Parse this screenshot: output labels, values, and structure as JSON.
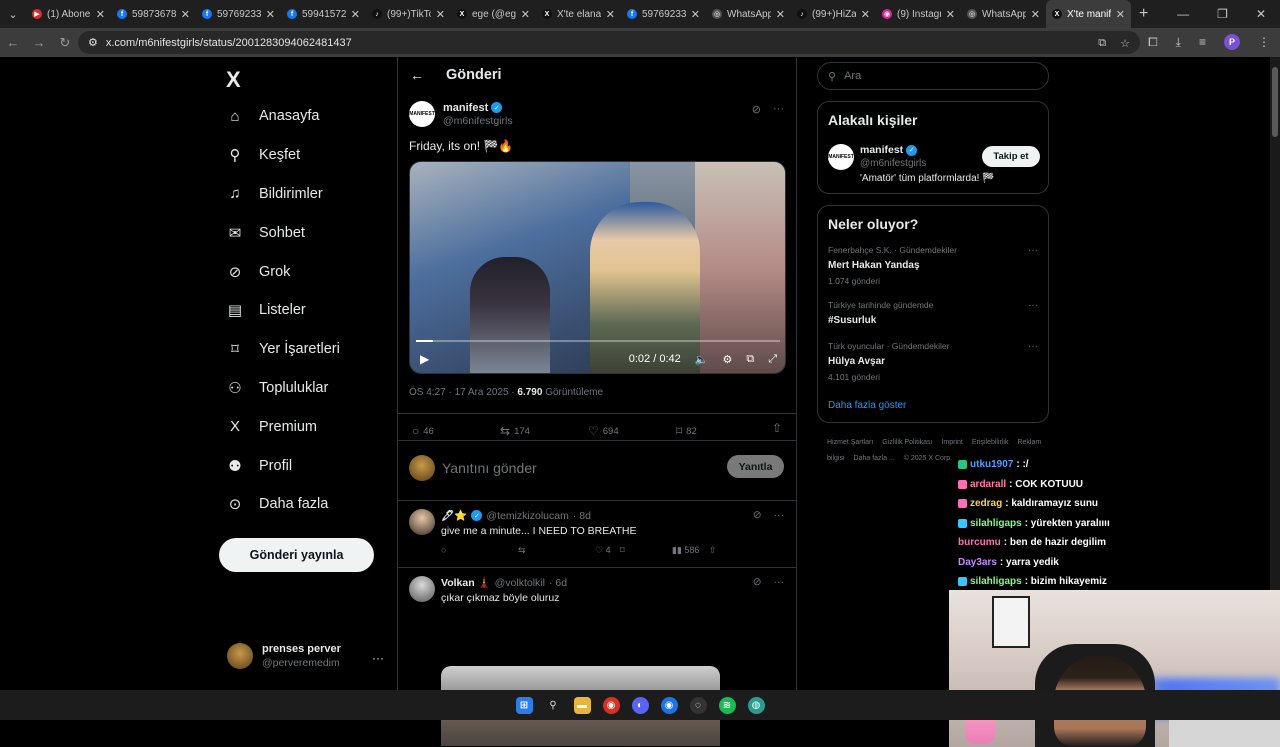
{
  "browser": {
    "tabs": [
      {
        "label": "(1) Abone",
        "color": "#e32b2b",
        "glyph": "▶"
      },
      {
        "label": "59873678",
        "color": "#1877f2",
        "glyph": "f"
      },
      {
        "label": "59769233",
        "color": "#1877f2",
        "glyph": "f"
      },
      {
        "label": "59941572",
        "color": "#1877f2",
        "glyph": "f"
      },
      {
        "label": "(99+)TikTo",
        "color": "#111111",
        "glyph": "♪"
      },
      {
        "label": "ege (@ege",
        "color": "#111111",
        "glyph": "X"
      },
      {
        "label": "X'te elanat",
        "color": "#111111",
        "glyph": "X"
      },
      {
        "label": "59769233",
        "color": "#1877f2",
        "glyph": "f"
      },
      {
        "label": "WhatsApp",
        "color": "#555555",
        "glyph": "◎"
      },
      {
        "label": "(99+)HiZa",
        "color": "#111111",
        "glyph": "♪"
      },
      {
        "label": "(9) Instagr",
        "color": "#d6249f",
        "glyph": "◉"
      },
      {
        "label": "WhatsApp",
        "color": "#555555",
        "glyph": "◎"
      },
      {
        "label": "X'te manif",
        "color": "#111111",
        "glyph": "X",
        "active": true
      }
    ],
    "url": "x.com/m6nifestgirls/status/2001283094062481437",
    "profile_initial": "P"
  },
  "nav": {
    "logo": "X",
    "items": [
      {
        "label": "Anasayfa",
        "icon": "⌂",
        "icon_name": "home-icon"
      },
      {
        "label": "Keşfet",
        "icon": "⚲",
        "icon_name": "search-icon"
      },
      {
        "label": "Bildirimler",
        "icon": "♫",
        "icon_name": "bell-icon"
      },
      {
        "label": "Sohbet",
        "icon": "✉",
        "icon_name": "mail-icon"
      },
      {
        "label": "Grok",
        "icon": "⊘",
        "icon_name": "grok-icon"
      },
      {
        "label": "Listeler",
        "icon": "▤",
        "icon_name": "list-icon"
      },
      {
        "label": "Yer İşaretleri",
        "icon": "⌑",
        "icon_name": "bookmark-icon"
      },
      {
        "label": "Topluluklar",
        "icon": "⚇",
        "icon_name": "communities-icon"
      },
      {
        "label": "Premium",
        "icon": "X",
        "icon_name": "premium-icon"
      },
      {
        "label": "Profil",
        "icon": "⚉",
        "icon_name": "profile-icon"
      },
      {
        "label": "Daha fazla",
        "icon": "⊙",
        "icon_name": "more-icon"
      }
    ],
    "post_button": "Gönderi yayınla",
    "me": {
      "name": "prenses perver",
      "handle": "@perveremedim",
      "more": "···"
    }
  },
  "post": {
    "header_title": "Gönderi",
    "author": "manifest",
    "avatar_text": "MANIFEST",
    "handle": "@m6nifestgirls",
    "text": "Friday, its on! 🏁🔥",
    "video": {
      "time": "0:02 / 0:42",
      "progress": 0.048
    },
    "time": "ÖS 4:27 · 17 Ara 2025 · ",
    "views": "6.790",
    "views_label": " Görüntüleme",
    "stats": {
      "replies": "46",
      "reposts": "174",
      "likes": "694",
      "bookmarks": "82"
    },
    "reply_placeholder": "Yanıtını gönder",
    "reply_button": "Yanıtla"
  },
  "replies": [
    {
      "name": "🖋⭐",
      "handle": "@temizkizolucam",
      "age": "· 8d",
      "text": "give me a minute... I NEED TO BREATHE",
      "likes": "4",
      "views": "586"
    },
    {
      "name": "Volkan 🗼",
      "handle": "@volktolkil",
      "age": "· 6d",
      "text": "çıkar çıkmaz böyle oluruz"
    }
  ],
  "sidebar": {
    "search_placeholder": "Ara",
    "related_title": "Alakalı kişiler",
    "suggest": {
      "name": "manifest",
      "handle": "@m6nifestgirls",
      "bio": "'Amatör' tüm platformlarda! 🏁",
      "follow": "Takip et"
    },
    "trending_title": "Neler oluyor?",
    "trends": [
      {
        "context": "Fenerbahçe S.K. · Gündemdekiler",
        "name": "Mert Hakan Yandaş",
        "count": "1.074 gönderi"
      },
      {
        "context": "Türkiye tarihinde gündemde",
        "name": "#Susurluk",
        "count": ""
      },
      {
        "context": "Türk oyuncular · Gündemdekiler",
        "name": "Hülya Avşar",
        "count": "4.101 gönderi"
      }
    ],
    "show_more": "Daha fazla göster",
    "footer": [
      "Hizmet Şartları",
      "Gizlilik Politikası",
      "Imprint",
      "Erişilebilirlik",
      "Reklam bilgisi",
      "Daha fazla ...",
      "© 2025 X Corp."
    ]
  },
  "chat": [
    {
      "user": "utku1907",
      "msg": ": :/",
      "color": "#4d9dff",
      "badge": "#2ec27e"
    },
    {
      "user": "ardarall",
      "msg": ": COK KOTUUU",
      "color": "#ff7aa8",
      "badge": "#ff6fb5"
    },
    {
      "user": "zedrag",
      "msg": ": kaldıramayız sunu",
      "color": "#ffd54a",
      "badge": "#ff6fb5"
    },
    {
      "user": "silahligaps",
      "msg": ": yürekten yaralıııı",
      "color": "#7dff7d",
      "badge": "#39c6ff"
    },
    {
      "user": "burcumu",
      "msg": ": ben de hazir degilim",
      "color": "#ff6fb5",
      "badge": ""
    },
    {
      "user": "Day3ars",
      "msg": ": yarra yedik",
      "color": "#c38bff",
      "badge": ""
    },
    {
      "user": "silahligaps",
      "msg": ": bizim hikayemiz",
      "color": "#7dff7d",
      "badge": "#39c6ff"
    }
  ]
}
